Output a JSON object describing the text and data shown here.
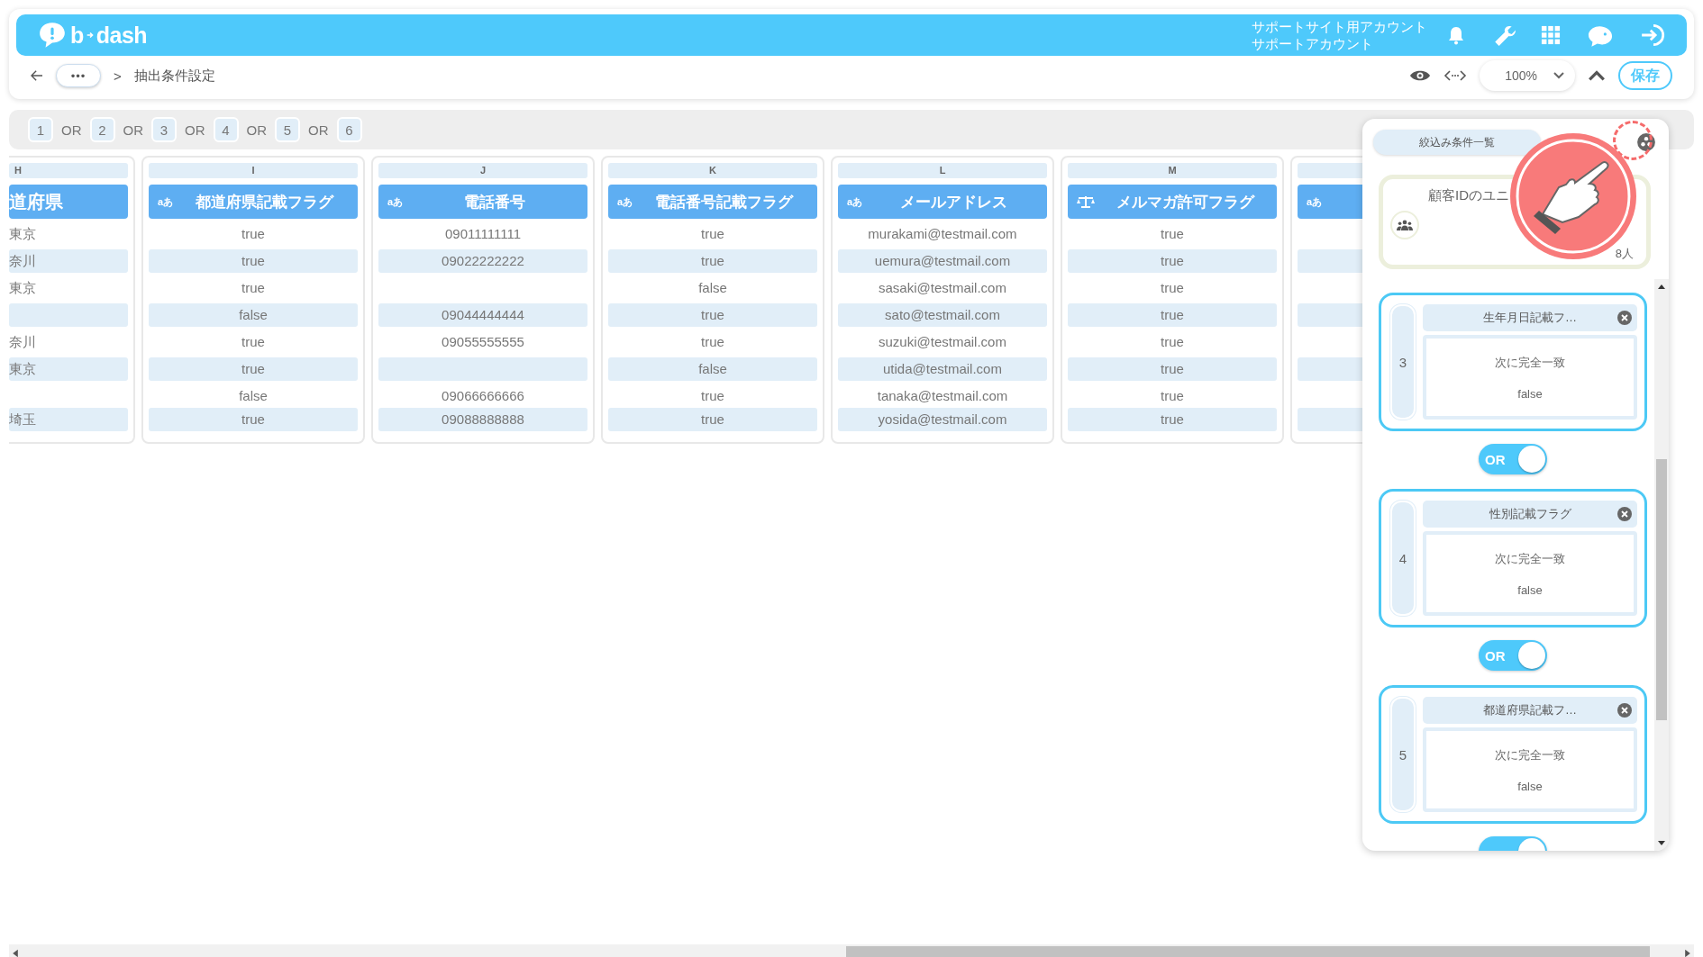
{
  "header": {
    "logo_left": "b",
    "logo_right": "dash",
    "account_lines": [
      "サポートサイト用アカウント",
      "サポートアカウント"
    ]
  },
  "toolbar": {
    "breadcrumb_more": "•••",
    "breadcrumb_separator": ">",
    "breadcrumb_current": "抽出条件設定",
    "zoom": "100%",
    "save": "保存"
  },
  "groups": {
    "items": [
      {
        "label": "1"
      },
      {
        "label": "2"
      },
      {
        "label": "3"
      },
      {
        "label": "4"
      },
      {
        "label": "5"
      },
      {
        "label": "6"
      }
    ],
    "separators": [
      "OR",
      "OR",
      "OR",
      "OR",
      "OR"
    ]
  },
  "table": {
    "columns": [
      {
        "letter": "H",
        "title": "道府県",
        "kind": "text",
        "cells": [
          "東京",
          "奈川",
          "東京",
          null,
          "奈川",
          "東京",
          null,
          "埼玉"
        ]
      },
      {
        "letter": "I",
        "title": "都道府県記載フラグ",
        "kind": "text",
        "type_badge": "aあ",
        "cells": [
          "true",
          "true",
          "true",
          "false",
          "true",
          "true",
          "false",
          "true"
        ]
      },
      {
        "letter": "J",
        "title": "電話番号",
        "kind": "text",
        "type_badge": "aあ",
        "cells": [
          "09011111111",
          "09022222222",
          null,
          "09044444444",
          "09055555555",
          null,
          "09066666666",
          "09088888888"
        ]
      },
      {
        "letter": "K",
        "title": "電話番号記載フラグ",
        "kind": "text",
        "type_badge": "aあ",
        "cells": [
          "true",
          "true",
          "false",
          "true",
          "true",
          "false",
          "true",
          "true"
        ]
      },
      {
        "letter": "L",
        "title": "メールアドレス",
        "kind": "text",
        "type_badge": "aあ",
        "cells": [
          "murakami@testmail.com",
          "uemura@testmail.com",
          "sasaki@testmail.com",
          "sato@testmail.com",
          "suzuki@testmail.com",
          "utida@testmail.com",
          "tanaka@testmail.com",
          "yosida@testmail.com"
        ]
      },
      {
        "letter": "M",
        "title": "メルマガ許可フラグ",
        "kind": "flag",
        "cells": [
          "true",
          "true",
          "true",
          "true",
          "true",
          "true",
          "true",
          "true"
        ]
      },
      {
        "kind": "text",
        "type_badge": "aあ"
      }
    ]
  },
  "panel": {
    "title": "絞込み条件一覧",
    "summary_card": {
      "label": "顧客IDのユニ",
      "count": "8人"
    },
    "conditions": [
      {
        "number": "3",
        "field": "生年月日記載フ…",
        "operator": "次に完全一致",
        "value": "false"
      },
      {
        "number": "4",
        "field": "性別記載フラグ",
        "operator": "次に完全一致",
        "value": "false"
      },
      {
        "number": "5",
        "field": "都道府県記載フ…",
        "operator": "次に完全一致",
        "value": "false"
      }
    ],
    "connectors": [
      {
        "label": "OR",
        "on": true
      },
      {
        "label": "OR",
        "on": true
      },
      {
        "on": true
      }
    ]
  }
}
